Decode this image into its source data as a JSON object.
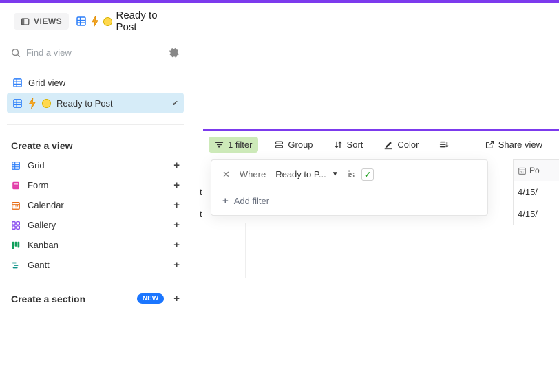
{
  "header": {
    "views_button": "VIEWS",
    "current_view_name": "Ready to Post"
  },
  "search": {
    "placeholder": "Find a view"
  },
  "views": [
    {
      "label": "Grid view",
      "active": false
    },
    {
      "label": "Ready to Post",
      "active": true
    }
  ],
  "create_view": {
    "title": "Create a view",
    "options": [
      {
        "label": "Grid",
        "icon": "grid",
        "color": "#2d7ff9"
      },
      {
        "label": "Form",
        "icon": "form",
        "color": "#e23da9"
      },
      {
        "label": "Calendar",
        "icon": "calendar",
        "color": "#e86c13"
      },
      {
        "label": "Gallery",
        "icon": "gallery",
        "color": "#7c3aed"
      },
      {
        "label": "Kanban",
        "icon": "kanban",
        "color": "#12a05c"
      },
      {
        "label": "Gantt",
        "icon": "gantt",
        "color": "#0d9488"
      }
    ]
  },
  "create_section": {
    "label": "Create a section",
    "badge": "NEW"
  },
  "toolbar": {
    "filter_label": "1 filter",
    "group_label": "Group",
    "sort_label": "Sort",
    "color_label": "Color",
    "share_label": "Share view"
  },
  "filter_popup": {
    "where_label": "Where",
    "field_label": "Ready to P...",
    "operator": "is",
    "value_checked": true,
    "add_filter": "Add filter"
  },
  "data": {
    "column_header": "Po",
    "rows": [
      {
        "name_fragment": "t",
        "value": "4/15/"
      },
      {
        "name_fragment": "t",
        "value": "4/15/"
      }
    ]
  }
}
